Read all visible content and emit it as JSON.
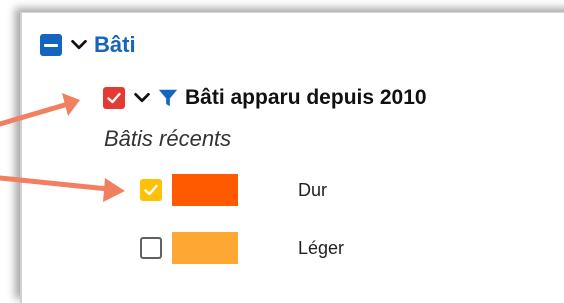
{
  "group": {
    "label": "Bâti",
    "check_state": "indeterminate",
    "expanded": true
  },
  "layer": {
    "label": "Bâti apparu depuis 2010",
    "checked": true,
    "expanded": true,
    "filter_icon": "funnel-icon"
  },
  "legend": {
    "subtitle": "Bâtis récents",
    "items": [
      {
        "label": "Dur",
        "checked": true,
        "color": "#ff5a00"
      },
      {
        "label": "Léger",
        "checked": false,
        "color": "#ffa733"
      }
    ]
  },
  "colors": {
    "accent_blue": "#1565c0",
    "layer_check": "#e53935",
    "item_check": "#ffc107",
    "annotation_arrow": "#f08060"
  }
}
